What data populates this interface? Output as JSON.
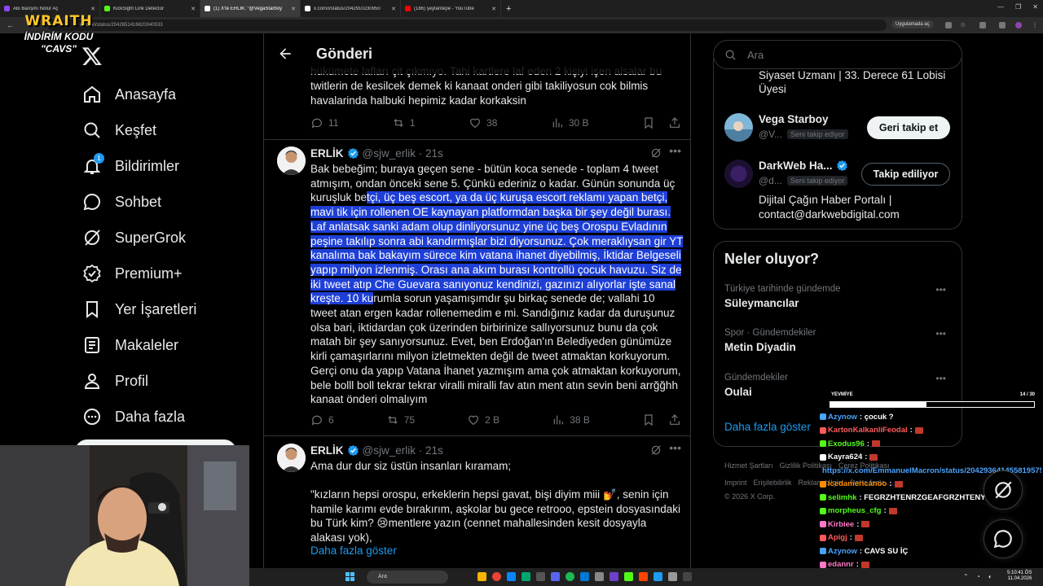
{
  "browser": {
    "tabs": [
      {
        "title": "Abi Barışmı Nolur Aç",
        "color": "#9146ff"
      },
      {
        "title": "KickSight Link Detector",
        "color": "#53fc18"
      },
      {
        "title": "(1) X'te ERLİK: \"@VegaStarboy",
        "color": "#ffffff"
      },
      {
        "title": "x.com/i/status/2042910230950",
        "color": "#ffffff"
      },
      {
        "title": "(186) şeytantepe - YouTube",
        "color": "#ff0000"
      }
    ],
    "url": "x.com/i/status/2042651416620040533",
    "app_button": "Uygulamada aç"
  },
  "overlay": {
    "brand": "WRAITH",
    "discount_line1": "İNDİRİM KODU",
    "discount_line2": "\"CAVS\""
  },
  "nav": {
    "items": [
      {
        "label": "Anasayfa",
        "icon": "home-icon"
      },
      {
        "label": "Keşfet",
        "icon": "search-icon"
      },
      {
        "label": "Bildirimler",
        "icon": "bell-icon",
        "badge": "1"
      },
      {
        "label": "Sohbet",
        "icon": "chat-icon"
      },
      {
        "label": "SuperGrok",
        "icon": "grok-icon"
      },
      {
        "label": "Premium+",
        "icon": "verified-icon"
      },
      {
        "label": "Yer İşaretleri",
        "icon": "bookmark-icon"
      },
      {
        "label": "Makaleler",
        "icon": "article-icon"
      },
      {
        "label": "Profil",
        "icon": "person-icon"
      },
      {
        "label": "Daha fazla",
        "icon": "more-circle-icon"
      }
    ]
  },
  "center": {
    "title": "Gönderi",
    "tweet0": {
      "text": "hükümete lafları çit çıkmıyo. Tahi kartlere laf eden 2 kişiyi işen alsalar bu twitlerin de kesilcek demek ki kanaat onderi gibi takiliyosun cok bilmis havalarinda halbuki hepimiz kadar korkaksin",
      "replies": "11",
      "reposts": "1",
      "likes": "38",
      "views": "30 B"
    },
    "tweet1": {
      "name": "ERLİK",
      "handle": "@sjw_erlik",
      "time": "· 21s",
      "text_before": "Bak bebeğim; buraya geçen sene - bütün koca senede - toplam 4 tweet atmışım, ondan önceki sene 5. Çünkü ederiniz o kadar. Günün sonunda üç kuruşluk be",
      "text_highlight": "tçi, üç beş escort, ya da üç kuruşa escort reklamı yapan betçi, mavi tik için rollenen OE kaynayan platformdan başka bir şey değil burası. Laf anlatsak sanki adam olup dinliyorsunuz yine üç beş Orospu Evladının peşine takılıp sonra abi kandırmışlar bizi diyorsunuz. Çok meraklıysan gir YT kanalıma bak bakayım sürece kim vatana ihanet diyebilmiş, İktidar Belgeseli yapıp milyon izlenmiş. Orası ana akım burası kontrollü çocuk havuzu. Siz de iki tweet atıp Che Guevara sanıyonuz kendinizi, gazınızı alıyorlar işte sanal kreşte. 10 ku",
      "text_after": "rumla sorun yaşamışımdır şu birkaç senede de; vallahi 10 tweet atan ergen kadar rollenemedim e mi. Sandığınız kadar da duruşunuz olsa bari, iktidardan çok üzerinden birbirinize sallıyorsunuz bunu da çok matah bir şey sanıyorsunuz. Evet, ben Erdoğan'ın Belediyeden günümüze kirli çamaşırlarını milyon izletmekten değil de tweet atmaktan korkuyorum. Gerçi onu da yapıp Vatana İhanet yazmışım ama çok atmaktan korkuyorum, bele bolll boll tekrar tekrar viralli miralli fav atın ment atın sevin beni arrğğhh kanaat önderi olmalıyım",
      "replies": "6",
      "reposts": "75",
      "likes": "2 B",
      "views": "38 B"
    },
    "tweet2": {
      "name": "ERLİK",
      "handle": "@sjw_erlik",
      "time": "· 21s",
      "para1": "Ama dur dur siz üstün insanları kıramam;",
      "para2_a": "\"kızların hepsi orospu, erkeklerin hepsi gavat, bişi diyim miii ",
      "para2_emoji": "💅",
      "para2_b": ", senin için hamile karımı evde bırakırım, aşkolar bu gece retrooo, epstein dosyasındaki bu Türk kim? ",
      "para2_emoji2": "😢",
      "para2_c": "mentlere yazın (cennet mahallesinden kesit dosyayla alakası yok),",
      "show_more": "Daha fazla göster"
    }
  },
  "right": {
    "search_placeholder": "Ara",
    "partial_bio": "Siyaset Uzmanı | 33. Derece 61 Lobisi Üyesi",
    "follows": [
      {
        "name": "Vega Starboy",
        "handle": "@V...",
        "tag": "Seni takip ediyor",
        "button": "Geri takip et"
      },
      {
        "name": "DarkWeb Ha...",
        "handle": "@d...",
        "tag": "Seni takip ediyor",
        "button": "Takip ediliyor",
        "bio": "Dijital Çağın Haber Portalı | contact@darkwebdigital.com"
      }
    ],
    "trends_title": "Neler oluyor?",
    "trends": [
      {
        "context": "Türkiye tarihinde gündemde",
        "topic": "Süleymancılar"
      },
      {
        "context": "Spor · Gündemdekiler",
        "topic": "Metin Diyadin"
      },
      {
        "context": "Gündemdekiler",
        "topic": "Oulai"
      }
    ],
    "show_more": "Daha fazla göster",
    "footer1": [
      "Hizmet Şartları",
      "Gizlilik Politikası",
      "Çerez Politikası"
    ],
    "footer2": [
      "Imprint",
      "Erişilebilirlik",
      "Reklam bilgisi",
      "Daha fazla ..."
    ],
    "copyright": "© 2026 X Corp."
  },
  "chat": {
    "bar_label": "YEVMİYE",
    "bar_count": "14 / 30",
    "bar_fraction": 0.47,
    "messages": [
      {
        "user": "Azynow",
        "color": "#4aa3ff",
        "text": ": çocuk ?"
      },
      {
        "user": "KartonKalkanliFeodal",
        "color": "#ff5a5a",
        "text": ":",
        "emote": true
      },
      {
        "user": "Exodus96",
        "color": "#53fc18",
        "text": ":",
        "emote": true
      },
      {
        "user": "Kayra624",
        "color": "#ffffff",
        "text": ":",
        "emote": true
      },
      {
        "user": "",
        "color": "#4aa3ff",
        "text": "https://x.com/EmmanuelMacron/status/2042936414558195754"
      },
      {
        "user": "icedamericanoo",
        "color": "#ff8c00",
        "text": ":",
        "emote": true
      },
      {
        "user": "selimhk",
        "color": "#53fc18",
        "text": ": FEGRZHTENRZGEAFGRZHTENYRB"
      },
      {
        "user": "morpheus_cfg",
        "color": "#53fc18",
        "text": ":",
        "emote": true
      },
      {
        "user": "Kirbiee",
        "color": "#ff79c6",
        "text": ":",
        "emote": true
      },
      {
        "user": "Apigj",
        "color": "#ff5a5a",
        "text": ":",
        "emote": true
      },
      {
        "user": "Azynow",
        "color": "#4aa3ff",
        "text": ": CAVS SU İÇ"
      },
      {
        "user": "edannr",
        "color": "#ff79c6",
        "text": ":",
        "emote": true
      }
    ]
  },
  "taskbar": {
    "search": "Ara",
    "time": "5:10:41 ÖS",
    "date": "11.04.2026"
  }
}
